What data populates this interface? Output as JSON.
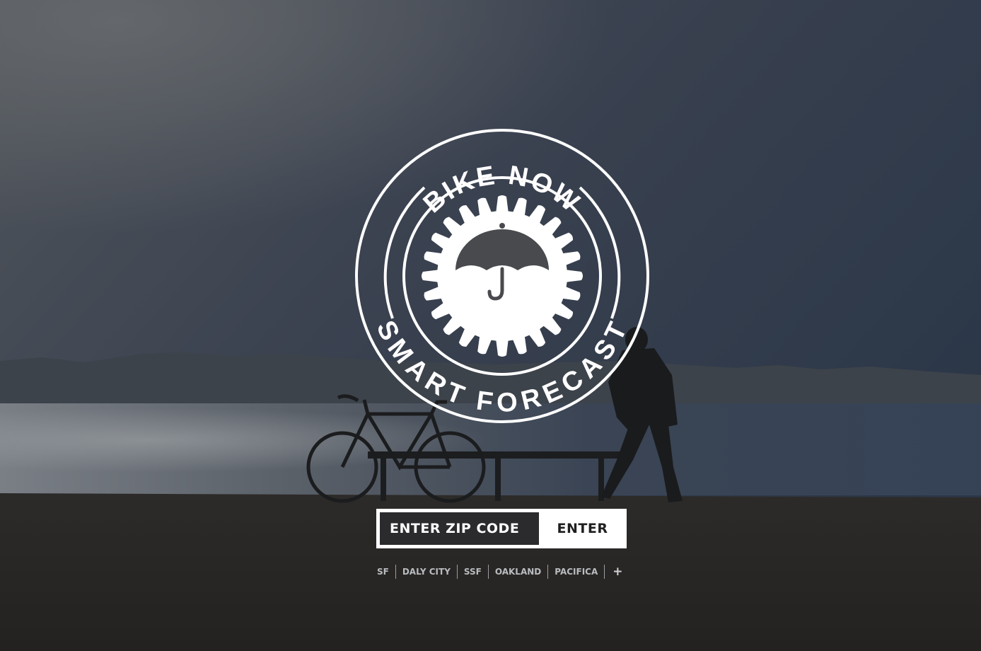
{
  "brand": {
    "top_text": "BIKE NOW",
    "bottom_text": "SMART FORECAST",
    "icon": "gear-umbrella-icon"
  },
  "zip_form": {
    "placeholder": "ENTER ZIP CODE",
    "value": "",
    "submit_label": "ENTER"
  },
  "cities": [
    {
      "label": "SF"
    },
    {
      "label": "DALY CITY"
    },
    {
      "label": "SSF"
    },
    {
      "label": "OAKLAND"
    },
    {
      "label": "PACIFICA"
    }
  ],
  "more_cities": {
    "label": "+",
    "icon": "plus-icon"
  },
  "colors": {
    "overlay": "#2a3038",
    "form_bg": "#ffffff",
    "input_bg": "#2b2b2d",
    "city_text": "#b9bcc0"
  }
}
